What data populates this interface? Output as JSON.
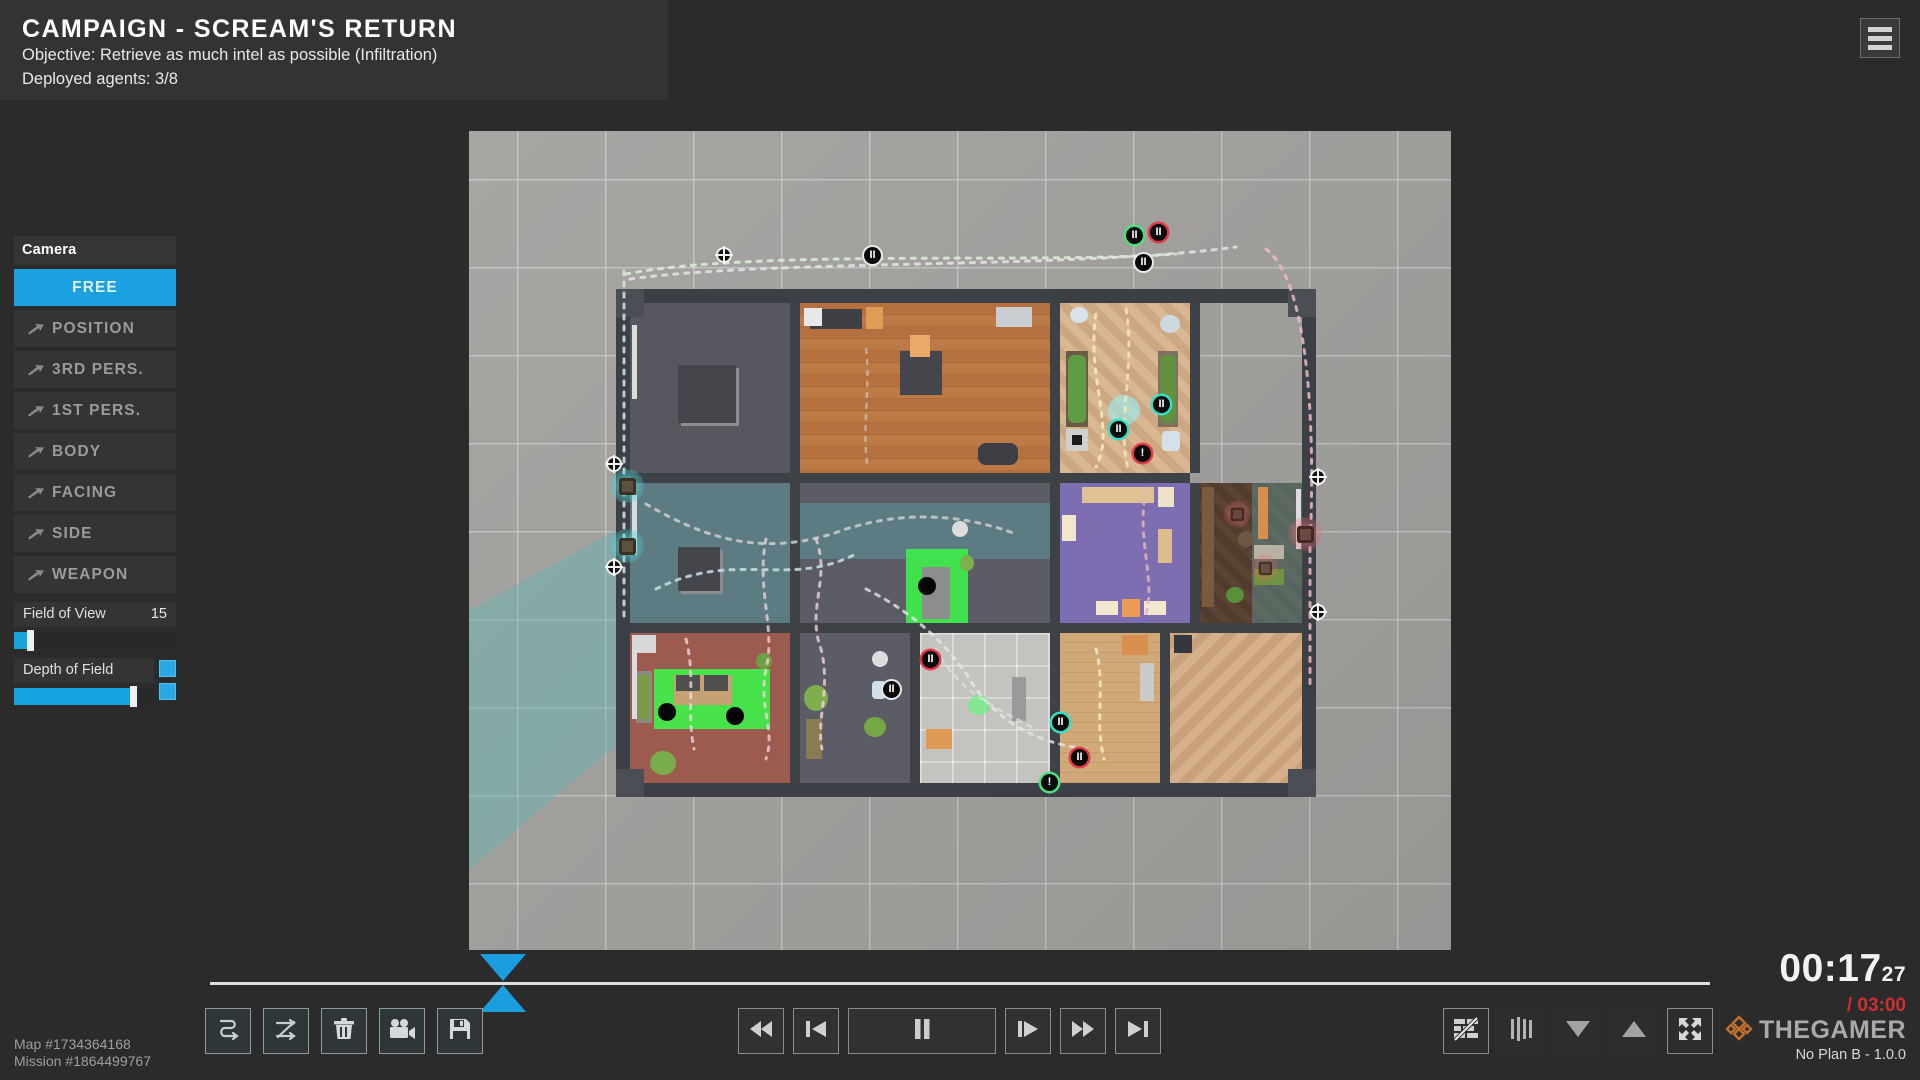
{
  "header": {
    "title": "CAMPAIGN - SCREAM'S RETURN",
    "objective": "Objective: Retrieve as much intel as possible (Infiltration)",
    "agents": "Deployed agents: 3/8",
    "menu_icon": "hamburger-menu-icon"
  },
  "camera_panel": {
    "header": "Camera",
    "modes": [
      {
        "label": "FREE",
        "active": true,
        "icon": "none"
      },
      {
        "label": "POSITION",
        "active": false,
        "icon": "pin-icon"
      },
      {
        "label": "3RD PERS.",
        "active": false,
        "icon": "pin-icon"
      },
      {
        "label": "1ST PERS.",
        "active": false,
        "icon": "pin-icon"
      },
      {
        "label": "BODY",
        "active": false,
        "icon": "pin-icon"
      },
      {
        "label": "FACING",
        "active": false,
        "icon": "pin-icon"
      },
      {
        "label": "SIDE",
        "active": false,
        "icon": "pin-icon"
      },
      {
        "label": "WEAPON",
        "active": false,
        "icon": "pin-icon"
      }
    ],
    "field_of_view": {
      "label": "Field of View",
      "value": "15",
      "fill_percent": 8
    },
    "depth_of_field": {
      "label": "Depth of Field",
      "value": "",
      "fill_percent": 83,
      "toggle_on": true
    }
  },
  "viewport": {
    "zoom_note": "",
    "vision_cone_color": "#60b4b6",
    "objective_zone_color": "#3ef04a"
  },
  "timeline": {
    "playhead_percent": 18
  },
  "left_tools": [
    {
      "name": "path-tool-button",
      "icon": "path-curve-icon",
      "label": ""
    },
    {
      "name": "reorder-tool-button",
      "icon": "swap-arrows-icon",
      "label": ""
    },
    {
      "name": "delete-tool-button",
      "icon": "trash-icon",
      "label": ""
    },
    {
      "name": "record-tool-button",
      "icon": "video-camera-icon",
      "label": ""
    },
    {
      "name": "save-tool-button",
      "icon": "floppy-save-icon",
      "label": ""
    }
  ],
  "transport": [
    {
      "name": "restart-button",
      "icon": "rewind-to-start-icon",
      "label": ""
    },
    {
      "name": "step-back-button",
      "icon": "step-back-icon",
      "label": ""
    },
    {
      "name": "pause-button",
      "icon": "pause-icon",
      "label": ""
    },
    {
      "name": "step-forward-button",
      "icon": "step-forward-icon",
      "label": ""
    },
    {
      "name": "fast-forward-button",
      "icon": "fast-forward-icon",
      "label": ""
    },
    {
      "name": "skip-to-end-button",
      "icon": "skip-to-end-icon",
      "label": ""
    }
  ],
  "right_tools": [
    {
      "name": "toggle-walls-button",
      "icon": "wall-hidden-icon",
      "active": true
    },
    {
      "name": "toggle-layers-button",
      "icon": "vertical-bars-icon",
      "active": false
    },
    {
      "name": "floor-down-button",
      "icon": "triangle-down-icon",
      "active": false
    },
    {
      "name": "floor-up-button",
      "icon": "triangle-up-icon",
      "active": false
    },
    {
      "name": "fullscreen-button",
      "icon": "expand-arrows-icon",
      "active": true
    }
  ],
  "footer": {
    "map_id": "Map #1734364168",
    "mission_id": "Mission #1864499767"
  },
  "clock": {
    "elapsed": "00:17",
    "frames": "27",
    "limit": "/ 03:00",
    "brand": "THEGAMER",
    "brand_icon": "thegamer-logo-icon",
    "version": "No Plan B - 1.0.0"
  }
}
